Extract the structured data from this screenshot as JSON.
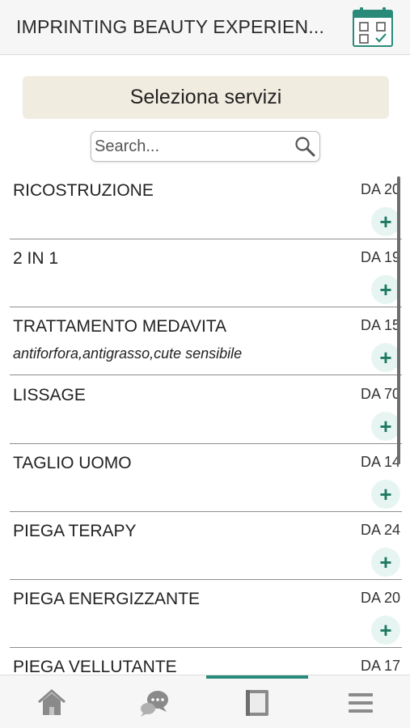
{
  "header": {
    "title": "IMPRINTING BEAUTY EXPERIEN...",
    "calendar_icon": "calendar-check-icon"
  },
  "banner": {
    "label": "Seleziona servizi"
  },
  "search": {
    "placeholder": "Search...",
    "value": "",
    "icon": "search-icon"
  },
  "services": [
    {
      "name": "RICOSTRUZIONE",
      "price": "DA 20",
      "description": ""
    },
    {
      "name": "2 IN 1",
      "price": "DA 19",
      "description": ""
    },
    {
      "name": "TRATTAMENTO MEDAVITA",
      "price": "DA 15",
      "description": "antiforfora,antigrasso,cute sensibile"
    },
    {
      "name": "LISSAGE",
      "price": "DA 70",
      "description": ""
    },
    {
      "name": "TAGLIO UOMO",
      "price": "DA 14",
      "description": ""
    },
    {
      "name": "PIEGA TERAPY",
      "price": "DA 24",
      "description": ""
    },
    {
      "name": "PIEGA ENERGIZZANTE",
      "price": "DA 20",
      "description": ""
    },
    {
      "name": "PIEGA VELLUTANTE",
      "price": "DA 17",
      "description": ""
    }
  ],
  "add_button_symbol": "+",
  "tabs": [
    {
      "icon": "home-icon",
      "active": false
    },
    {
      "icon": "chat-icon",
      "active": false
    },
    {
      "icon": "book-icon",
      "active": true
    },
    {
      "icon": "menu-icon",
      "active": false
    }
  ],
  "colors": {
    "accent": "#2a8a7a",
    "banner": "#f1ece0",
    "add_button_bg": "#e7f5f2",
    "add_button_fg": "#1f7a63"
  }
}
